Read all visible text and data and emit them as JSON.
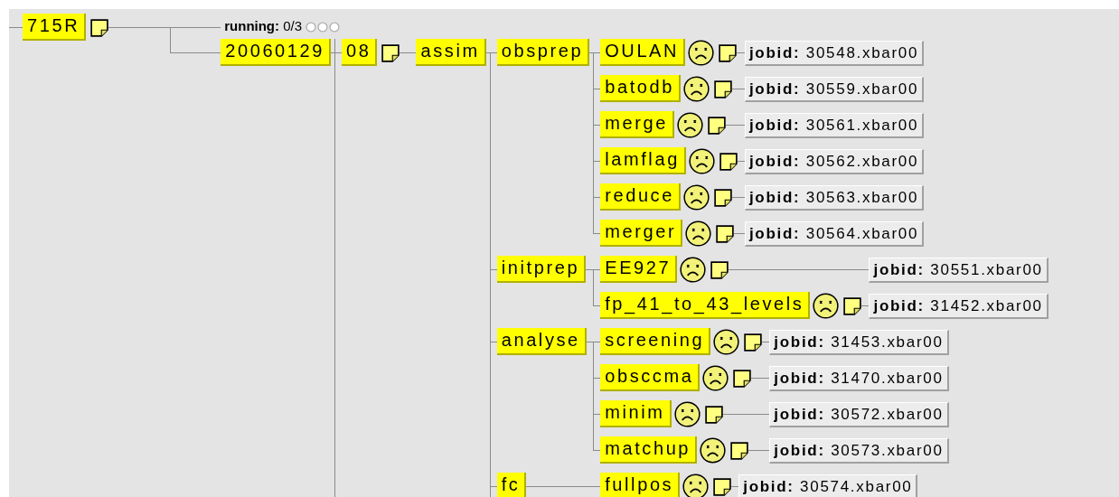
{
  "tree": {
    "label": "715R",
    "note": true,
    "more_below": false,
    "status_line": {
      "text": "**running:** 0/3",
      "slots": [
        {
          "filled": false
        },
        {
          "filled": false
        },
        {
          "filled": false
        }
      ]
    },
    "children": [
      {
        "label": "20060129",
        "note": false,
        "more_below": true,
        "children": [
          {
            "label": "08",
            "note": true,
            "more_below": false,
            "children": [
              {
                "label": "assim",
                "note": false,
                "more_below": true,
                "children": [
                  {
                    "label": "obsprep",
                    "note": false,
                    "more_below": false,
                    "children": [
                      {
                        "label": "OULAN",
                        "note": true,
                        "aborted": true,
                        "jobid": "**jobid:** 30548.xbar00"
                      },
                      {
                        "label": "batodb",
                        "note": true,
                        "aborted": true,
                        "jobid": "**jobid:** 30559.xbar00"
                      },
                      {
                        "label": "merge",
                        "note": true,
                        "aborted": true,
                        "jobid": "**jobid:** 30561.xbar00"
                      },
                      {
                        "label": "lamflag",
                        "note": true,
                        "aborted": true,
                        "jobid": "**jobid:** 30562.xbar00"
                      },
                      {
                        "label": "reduce",
                        "note": true,
                        "aborted": true,
                        "jobid": "**jobid:** 30563.xbar00"
                      },
                      {
                        "label": "merger",
                        "note": true,
                        "aborted": true,
                        "jobid": "**jobid:** 30564.xbar00"
                      }
                    ]
                  },
                  {
                    "label": "initprep",
                    "note": false,
                    "more_below": false,
                    "children": [
                      {
                        "label": "EE927",
                        "note": true,
                        "aborted": true,
                        "jobid": "**jobid:** 30551.xbar00"
                      },
                      {
                        "label": "fp_41_to_43_levels",
                        "note": true,
                        "aborted": true,
                        "jobid": "**jobid:** 31452.xbar00"
                      }
                    ]
                  },
                  {
                    "label": "analyse",
                    "note": false,
                    "more_below": false,
                    "children": [
                      {
                        "label": "screening",
                        "note": true,
                        "aborted": true,
                        "jobid": "**jobid:** 31453.xbar00"
                      },
                      {
                        "label": "obsccma",
                        "note": true,
                        "aborted": true,
                        "jobid": "**jobid:** 31470.xbar00"
                      },
                      {
                        "label": "minim",
                        "note": true,
                        "aborted": true,
                        "jobid": "**jobid:** 30572.xbar00"
                      },
                      {
                        "label": "matchup",
                        "note": true,
                        "aborted": true,
                        "jobid": "**jobid:** 30573.xbar00"
                      }
                    ]
                  },
                  {
                    "label": "fc",
                    "note": false,
                    "more_below": false,
                    "children": [
                      {
                        "label": "fullpos",
                        "note": true,
                        "aborted": true,
                        "jobid": "**jobid:** 30574.xbar00"
                      }
                    ]
                  }
                ]
              }
            ]
          }
        ]
      }
    ]
  }
}
